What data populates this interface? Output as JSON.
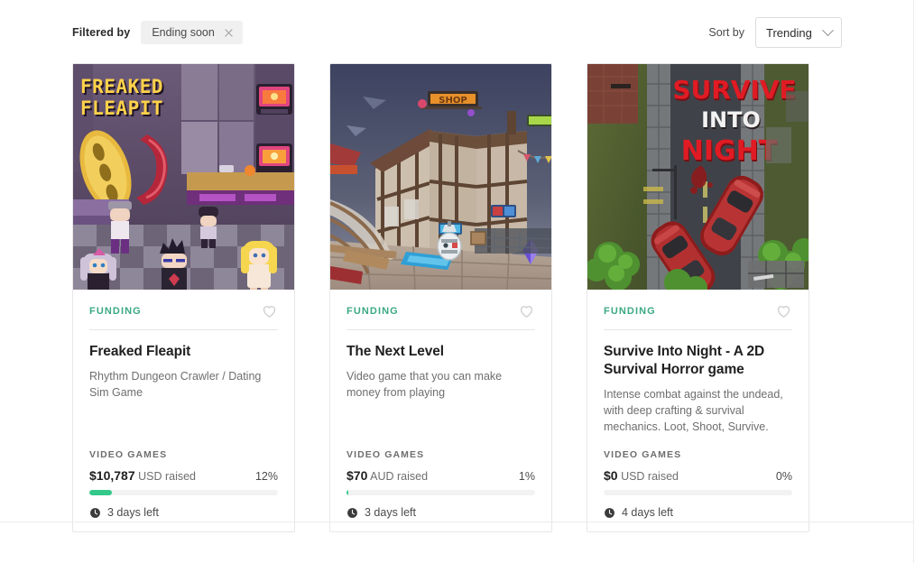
{
  "filter_bar": {
    "filtered_by_label": "Filtered by",
    "chip": {
      "label": "Ending soon",
      "close_icon": "close-icon"
    },
    "sort_by_label": "Sort by",
    "sort_value": "Trending",
    "sort_chevron_icon": "chevron-down-icon"
  },
  "colors": {
    "tag_green": "#3aa981",
    "progress_green": "#34c98a",
    "track_gray": "#f2f2f2",
    "chip_bg": "#f0f0f0",
    "card_border": "#e7e7e7"
  },
  "cards": [
    {
      "tag": "FUNDING",
      "favorite_icon": "heart-icon",
      "title": "Freaked Fleapit",
      "description": "Rhythm Dungeon Crawler / Dating Sim Game",
      "category": "VIDEO GAMES",
      "amount": "$10,787",
      "currency_raised": "USD raised",
      "percent": "12%",
      "progress_value": 12,
      "time_icon": "clock-icon",
      "time_left": "3 days left",
      "art": {
        "kind": "pixel-arcade",
        "title_text_line1": "FREAKED",
        "title_text_line2": "FLEAPIT"
      }
    },
    {
      "tag": "FUNDING",
      "favorite_icon": "heart-icon",
      "title": "The Next Level",
      "description": "Video game that you can make money from playing",
      "category": "VIDEO GAMES",
      "amount": "$70",
      "currency_raised": "AUD raised",
      "percent": "1%",
      "progress_value": 1,
      "time_icon": "clock-icon",
      "time_left": "3 days left",
      "art": {
        "kind": "tudor-town"
      }
    },
    {
      "tag": "FUNDING",
      "favorite_icon": "heart-icon",
      "title": "Survive Into Night - A 2D Survival Horror game",
      "description": "Intense combat against the undead, with deep crafting & survival mechanics. Loot, Shoot, Survive.",
      "category": "VIDEO GAMES",
      "amount": "$0",
      "currency_raised": "USD raised",
      "percent": "0%",
      "progress_value": 0,
      "time_icon": "clock-icon",
      "time_left": "4 days left",
      "art": {
        "kind": "survive-night",
        "title_line1": "SURVIVE",
        "title_line2": "INTO",
        "title_line3": "NIGHT"
      }
    }
  ]
}
